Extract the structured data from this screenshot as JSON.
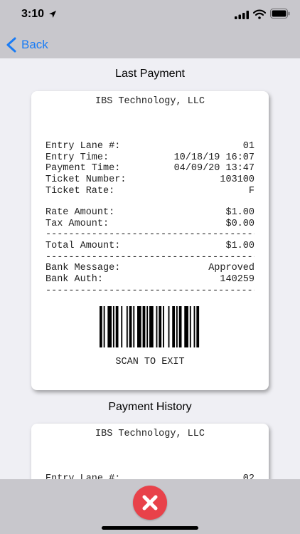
{
  "status": {
    "time": "3:10"
  },
  "nav": {
    "back_label": "Back"
  },
  "last_payment": {
    "title": "Last Payment",
    "company": "IBS Technology, LLC",
    "rows": [
      {
        "label": "Entry Lane #:",
        "value": "01"
      },
      {
        "label": "Entry Time:",
        "value": "10/18/19 16:07"
      },
      {
        "label": "Payment Time:",
        "value": "04/09/20 13:47"
      },
      {
        "label": "Ticket Number:",
        "value": "103100"
      },
      {
        "label": "Ticket Rate:",
        "value": "F"
      },
      {
        "label": "Rate Amount:",
        "value": "$1.00"
      },
      {
        "label": "Tax Amount:",
        "value": "$0.00"
      },
      {
        "label": "Total Amount:",
        "value": "$1.00"
      },
      {
        "label": "Bank Message:",
        "value": "Approved"
      },
      {
        "label": "Bank Auth:",
        "value": "140259"
      }
    ],
    "divider": "-------------------------------------",
    "scan_text": "SCAN TO EXIT"
  },
  "payment_history": {
    "title": "Payment History",
    "company": "IBS Technology, LLC",
    "rows": [
      {
        "label": "Entry Lane #:",
        "value": "02"
      }
    ]
  },
  "colors": {
    "accent": "#1a7cf5",
    "close": "#e8424a",
    "bars": "#c8c7cc"
  }
}
